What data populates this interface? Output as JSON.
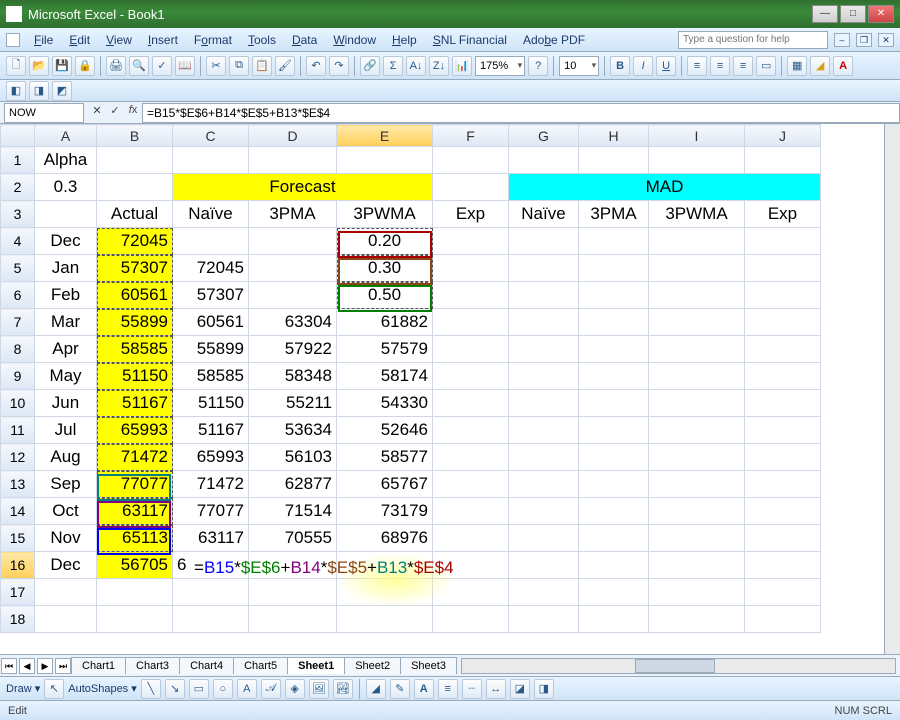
{
  "window": {
    "title": "Microsoft Excel - Book1"
  },
  "menus": [
    "File",
    "Edit",
    "View",
    "Insert",
    "Format",
    "Tools",
    "Data",
    "Window",
    "Help",
    "SNL Financial",
    "Adobe PDF"
  ],
  "helpbox_placeholder": "Type a question for help",
  "toolbar": {
    "zoom": "175%",
    "font_size": "10"
  },
  "namebox": "NOW",
  "formula": "=B15*$E$6+B14*$E$5+B13*$E$4",
  "cols": [
    "A",
    "B",
    "C",
    "D",
    "E",
    "F",
    "G",
    "H",
    "I",
    "J"
  ],
  "active_col": "E",
  "active_row": 16,
  "rows": [
    {
      "n": 1,
      "A": "Alpha"
    },
    {
      "n": 2,
      "A": "0.3",
      "CDE_merge": "Forecast",
      "GHIJ_merge": "MAD"
    },
    {
      "n": 3,
      "B": "Actual",
      "C": "Naïve",
      "D": "3PMA",
      "E": "3PWMA",
      "F": "Exp",
      "G": "Naïve",
      "H": "3PMA",
      "I": "3PWMA",
      "J": "Exp"
    },
    {
      "n": 4,
      "A": "Dec",
      "B": "72045",
      "E": "0.20"
    },
    {
      "n": 5,
      "A": "Jan",
      "B": "57307",
      "C": "72045",
      "E": "0.30"
    },
    {
      "n": 6,
      "A": "Feb",
      "B": "60561",
      "C": "57307",
      "E": "0.50"
    },
    {
      "n": 7,
      "A": "Mar",
      "B": "55899",
      "C": "60561",
      "D": "63304",
      "E": "61882"
    },
    {
      "n": 8,
      "A": "Apr",
      "B": "58585",
      "C": "55899",
      "D": "57922",
      "E": "57579"
    },
    {
      "n": 9,
      "A": "May",
      "B": "51150",
      "C": "58585",
      "D": "58348",
      "E": "58174"
    },
    {
      "n": 10,
      "A": "Jun",
      "B": "51167",
      "C": "51150",
      "D": "55211",
      "E": "54330"
    },
    {
      "n": 11,
      "A": "Jul",
      "B": "65993",
      "C": "51167",
      "D": "53634",
      "E": "52646"
    },
    {
      "n": 12,
      "A": "Aug",
      "B": "71472",
      "C": "65993",
      "D": "56103",
      "E": "58577"
    },
    {
      "n": 13,
      "A": "Sep",
      "B": "77077",
      "C": "71472",
      "D": "62877",
      "E": "65767"
    },
    {
      "n": 14,
      "A": "Oct",
      "B": "63117",
      "C": "77077",
      "D": "71514",
      "E": "73179"
    },
    {
      "n": 15,
      "A": "Nov",
      "B": "65113",
      "C": "63117",
      "D": "70555",
      "E": "68976"
    },
    {
      "n": 16,
      "A": "Dec",
      "B": "56705",
      "C": "6"
    },
    {
      "n": 17
    },
    {
      "n": 18
    }
  ],
  "formula_tokens": [
    {
      "t": "=",
      "c": ""
    },
    {
      "t": "B15",
      "c": "ref-blue"
    },
    {
      "t": "*",
      "c": ""
    },
    {
      "t": "$E$6",
      "c": "ref-green"
    },
    {
      "t": "+",
      "c": ""
    },
    {
      "t": "B14",
      "c": "ref-purple"
    },
    {
      "t": "*",
      "c": ""
    },
    {
      "t": "$E$5",
      "c": "ref-brown"
    },
    {
      "t": "+",
      "c": ""
    },
    {
      "t": "B13",
      "c": "ref-teal"
    },
    {
      "t": "*",
      "c": ""
    },
    {
      "t": "$E$4",
      "c": "ref-red"
    }
  ],
  "tabs": [
    "Chart1",
    "Chart3",
    "Chart4",
    "Chart5",
    "Sheet1",
    "Sheet2",
    "Sheet3"
  ],
  "active_tab": "Sheet1",
  "drawbar_label": "Draw",
  "autoshapes_label": "AutoShapes",
  "status_left": "Edit",
  "status_right": "NUM  SCRL"
}
